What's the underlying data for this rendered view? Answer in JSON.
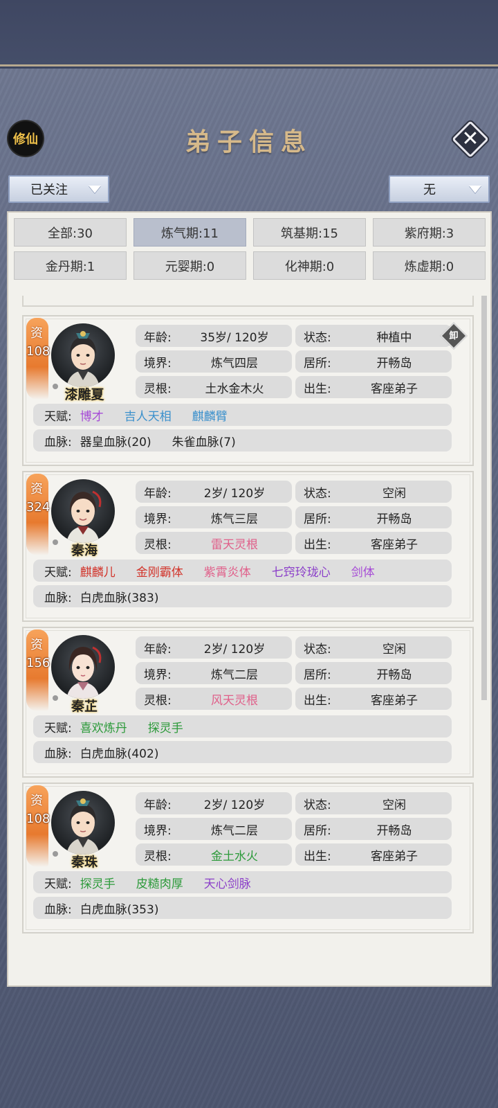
{
  "header": {
    "badge": "修仙",
    "title": "弟子信息"
  },
  "filters": {
    "left_dropdown": "已关注",
    "right_dropdown": "无",
    "tabs": [
      {
        "label": "全部:30",
        "active": false
      },
      {
        "label": "炼气期:11",
        "active": true
      },
      {
        "label": "筑基期:15",
        "active": false
      },
      {
        "label": "紫府期:3",
        "active": false
      },
      {
        "label": "金丹期:1",
        "active": false
      },
      {
        "label": "元婴期:0",
        "active": false
      },
      {
        "label": "化神期:0",
        "active": false
      },
      {
        "label": "炼虚期:0",
        "active": false
      }
    ]
  },
  "labels": {
    "aptitude": "资",
    "age": "年龄:",
    "realm": "境界:",
    "root": "灵根:",
    "state": "状态:",
    "home": "居所:",
    "birth": "出生:",
    "talent": "天赋:",
    "blood": "血脉:"
  },
  "disciples": [
    {
      "name": "漆雕夏",
      "aptitude": "108",
      "age": "35岁/ 120岁",
      "realm": "炼气四层",
      "root": "土水金木火",
      "state": "种植中",
      "home": "开畅岛",
      "birth": "客座弟子",
      "badge": "卸",
      "talents": [
        {
          "text": "博才",
          "color": "#a64bd6"
        },
        {
          "text": "吉人天相",
          "color": "#3a90cc"
        },
        {
          "text": "麒麟臂",
          "color": "#3a90cc"
        }
      ],
      "bloodlines": [
        "器皇血脉(20)",
        "朱雀血脉(7)"
      ]
    },
    {
      "name": "秦海",
      "aptitude": "324",
      "age": "2岁/ 120岁",
      "realm": "炼气三层",
      "root": "雷天灵根",
      "state": "空闲",
      "home": "开畅岛",
      "birth": "客座弟子",
      "talents": [
        {
          "text": "麒麟儿",
          "color": "#d2352c"
        },
        {
          "text": "金刚霸体",
          "color": "#d2352c"
        },
        {
          "text": "紫霄炎体",
          "color": "#e0608a"
        },
        {
          "text": "七窍玲珑心",
          "color": "#8b3fc9"
        },
        {
          "text": "剑体",
          "color": "#a64bd6"
        }
      ],
      "bloodlines": [
        "白虎血脉(383)"
      ]
    },
    {
      "name": "秦芷",
      "aptitude": "156",
      "age": "2岁/ 120岁",
      "realm": "炼气二层",
      "root": "风天灵根",
      "state": "空闲",
      "home": "开畅岛",
      "birth": "客座弟子",
      "talents": [
        {
          "text": "喜欢炼丹",
          "color": "#2c9a3a"
        },
        {
          "text": "探灵手",
          "color": "#2c9a3a"
        }
      ],
      "bloodlines": [
        "白虎血脉(402)"
      ]
    },
    {
      "name": "秦珠",
      "aptitude": "108",
      "age": "2岁/ 120岁",
      "realm": "炼气二层",
      "root": "金土水火",
      "state": "空闲",
      "home": "开畅岛",
      "birth": "客座弟子",
      "talents": [
        {
          "text": "探灵手",
          "color": "#2c9a3a"
        },
        {
          "text": "皮糙肉厚",
          "color": "#2c9a3a"
        },
        {
          "text": "天心剑脉",
          "color": "#8b3fc9"
        }
      ],
      "bloodlines": [
        "白虎血脉(353)"
      ]
    }
  ],
  "colors": {
    "root_plain": "#222222",
    "root_pink": "#e0608a",
    "root_green": "#2c9a3a"
  }
}
